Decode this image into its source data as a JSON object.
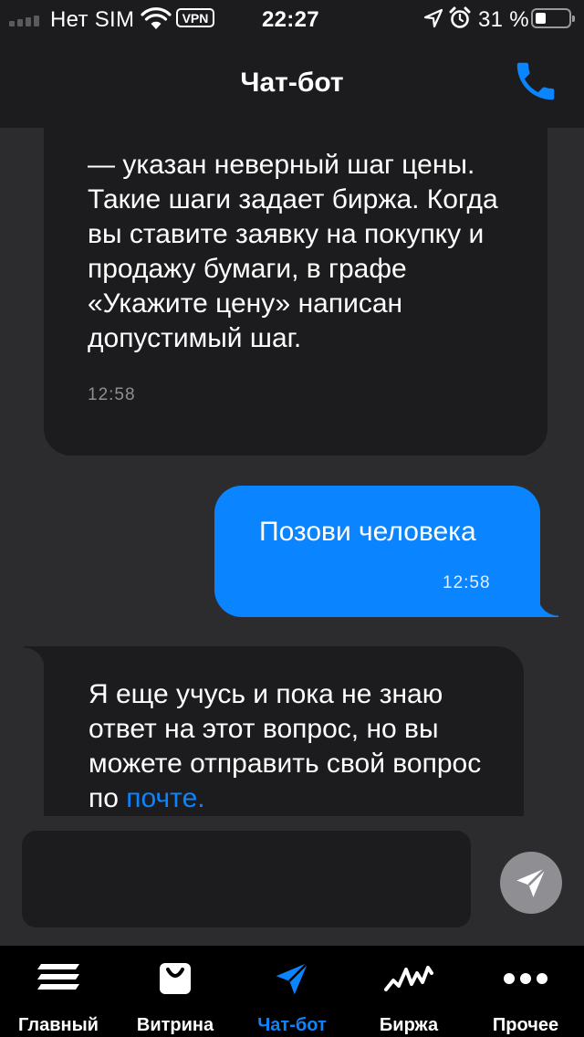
{
  "status_bar": {
    "carrier": "Нет SIM",
    "vpn": "VPN",
    "time": "22:27",
    "battery_percent": "31 %",
    "battery_level": 0.31,
    "icons": [
      "signal-icon",
      "wifi-icon",
      "location-arrow-icon",
      "alarm-icon",
      "battery-icon"
    ]
  },
  "header": {
    "title": "Чат-бот",
    "call_icon": "phone-icon"
  },
  "messages": [
    {
      "sender": "bot",
      "text": "— указан неверный шаг цены. Такие шаги задает биржа. Когда вы ставите заявку на покупку и продажу бумаги, в графе «Укажите цену» написан допустимый шаг.",
      "time": "12:58"
    },
    {
      "sender": "user",
      "text": "Позови человека",
      "time": "12:58"
    },
    {
      "sender": "bot",
      "text_before_link": "Я еще учусь и пока не знаю ответ на этот вопрос, но вы можете отправить свой вопрос по ",
      "link_text": "почте."
    }
  ],
  "composer": {
    "input_value": "",
    "placeholder": "",
    "send_icon": "send-arrow-icon"
  },
  "tab_bar": {
    "active": "chat",
    "tabs": [
      {
        "id": "home",
        "label": "Главный",
        "icon": "stack-lines-icon"
      },
      {
        "id": "showcase",
        "label": "Витрина",
        "icon": "shopping-bag-icon"
      },
      {
        "id": "chat",
        "label": "Чат-бот",
        "icon": "paper-plane-icon"
      },
      {
        "id": "exchange",
        "label": "Биржа",
        "icon": "activity-line-icon"
      },
      {
        "id": "more",
        "label": "Прочее",
        "icon": "more-dots-icon"
      }
    ]
  },
  "colors": {
    "accent": "#0a84ff",
    "background": "#2c2c2e",
    "bubble_bot": "#1c1c1e",
    "bar": "#000000"
  }
}
